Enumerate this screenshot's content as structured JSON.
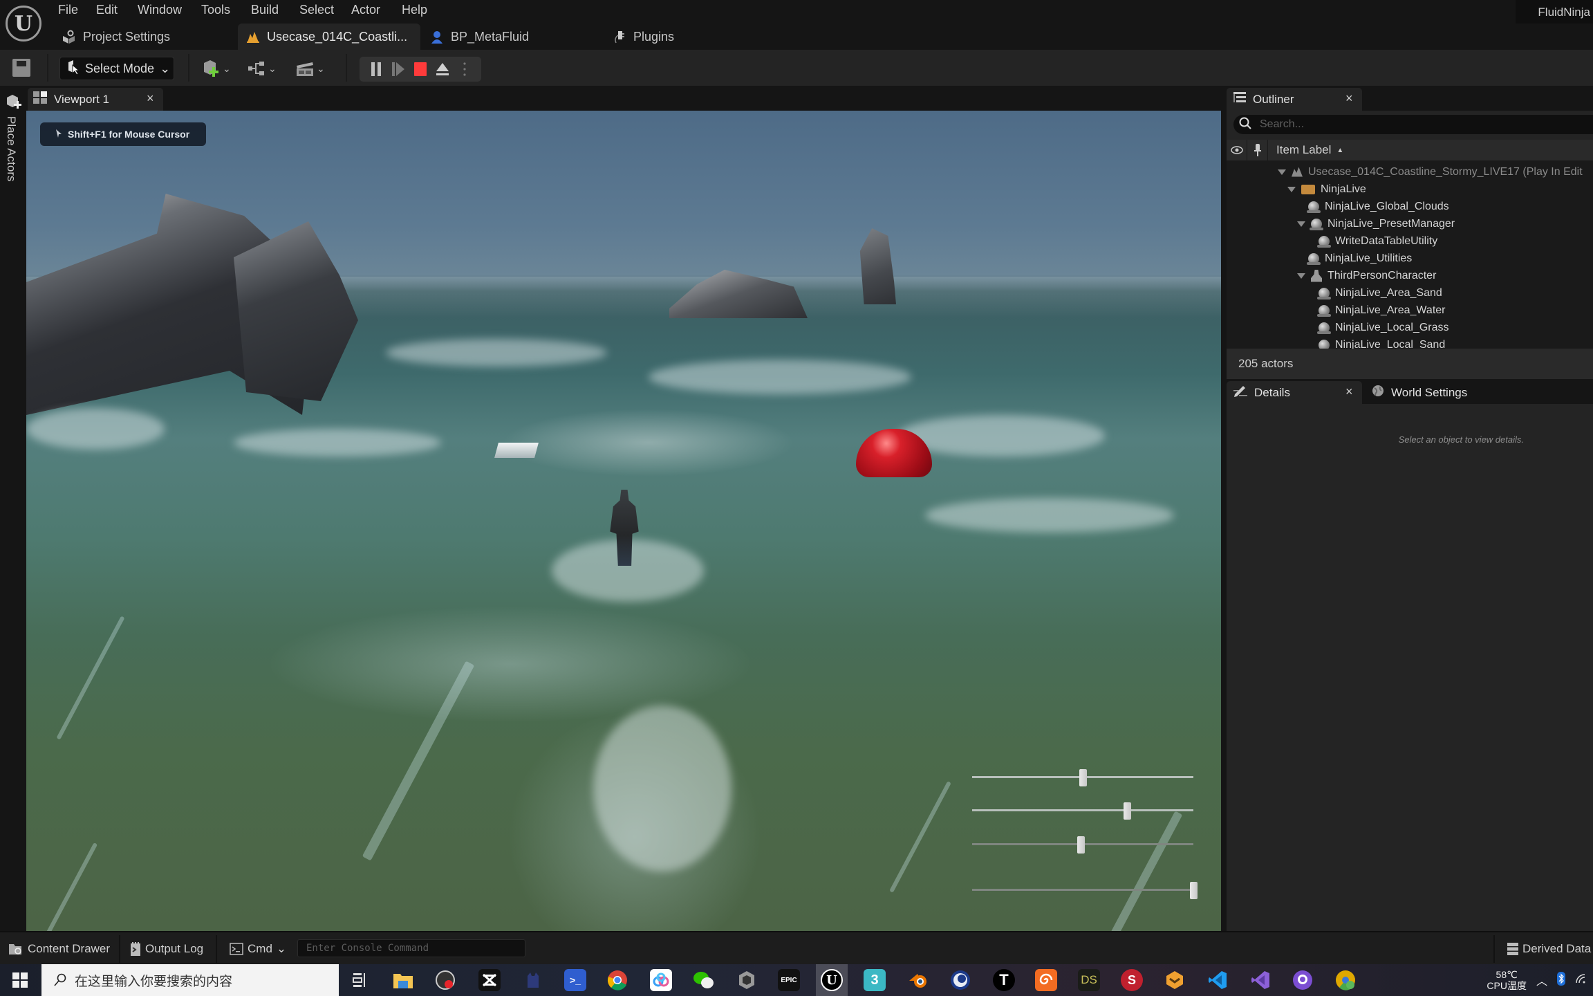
{
  "app": {
    "logo_glyph": "U",
    "project_name": "FluidNinja"
  },
  "menu": {
    "items": [
      "File",
      "Edit",
      "Window",
      "Tools",
      "Build",
      "Select",
      "Actor",
      "Help"
    ]
  },
  "document_tabs": [
    {
      "label": "Project Settings",
      "icon": "settings-icon",
      "active": false
    },
    {
      "label": "Usecase_014C_Coastli...",
      "icon": "level-icon",
      "active": true
    },
    {
      "label": "BP_MetaFluid",
      "icon": "blueprint-icon",
      "active": false
    },
    {
      "label": "Plugins",
      "icon": "plugin-icon",
      "active": false
    }
  ],
  "toolbar": {
    "save_icon": "save-icon",
    "select_mode_label": "Select Mode",
    "add_actor_icon": "add-actor-icon",
    "blueprint_icon": "blueprint-graph-icon",
    "cinematics_icon": "clapperboard-icon",
    "play_controls": [
      "pause-icon",
      "step-icon",
      "stop-icon",
      "eject-icon",
      "more-icon"
    ],
    "stop_color": "#ff3b3b"
  },
  "side_strip": {
    "place_actors_label": "Place Actors"
  },
  "viewport": {
    "tab_label": "Viewport 1",
    "mouse_hint": "Shift+F1 for Mouse Cursor",
    "sliders": [
      {
        "value": 0.5
      },
      {
        "value": 0.7
      },
      {
        "value": 0.49
      },
      {
        "value": 1.0
      }
    ]
  },
  "outliner": {
    "tab_label": "Outliner",
    "search_placeholder": "Search...",
    "column_label": "Item Label",
    "items": [
      {
        "label": "Usecase_014C_Coastline_Stormy_LIVE17 (Play In Edit",
        "depth": 0,
        "icon": "level",
        "expanded": true,
        "dim": true
      },
      {
        "label": "NinjaLive",
        "depth": 1,
        "icon": "folder",
        "expanded": true
      },
      {
        "label": "NinjaLive_Global_Clouds",
        "depth": 2,
        "icon": "actor"
      },
      {
        "label": "NinjaLive_PresetManager",
        "depth": 2,
        "icon": "actor",
        "expanded": true
      },
      {
        "label": "WriteDataTableUtility",
        "depth": 3,
        "icon": "actor"
      },
      {
        "label": "NinjaLive_Utilities",
        "depth": 2,
        "icon": "actor"
      },
      {
        "label": "ThirdPersonCharacter",
        "depth": 2,
        "icon": "character",
        "expanded": true
      },
      {
        "label": "NinjaLive_Area_Sand",
        "depth": 3,
        "icon": "actor"
      },
      {
        "label": "NinjaLive_Area_Water",
        "depth": 3,
        "icon": "actor"
      },
      {
        "label": "NinjaLive_Local_Grass",
        "depth": 3,
        "icon": "actor"
      },
      {
        "label": "NinjaLive_Local_Sand",
        "depth": 3,
        "icon": "actor"
      }
    ],
    "actor_count": "205 actors"
  },
  "details": {
    "tab_label": "Details",
    "world_settings_label": "World Settings",
    "empty_message": "Select an object to view details."
  },
  "bottom_bar": {
    "content_drawer": "Content Drawer",
    "output_log": "Output Log",
    "cmd_label": "Cmd",
    "console_placeholder": "Enter Console Command",
    "derived_data": "Derived Data"
  },
  "taskbar": {
    "search_placeholder": "在这里输入你要搜索的内容",
    "apps": [
      {
        "name": "task-view",
        "label": ""
      },
      {
        "name": "file-explorer",
        "label": ""
      },
      {
        "name": "obs",
        "label": ""
      },
      {
        "name": "capcut",
        "label": ""
      },
      {
        "name": "cat-app",
        "label": ""
      },
      {
        "name": "powershell",
        "label": ">_"
      },
      {
        "name": "chrome",
        "label": ""
      },
      {
        "name": "baidu-netdisk",
        "label": ""
      },
      {
        "name": "wechat",
        "label": ""
      },
      {
        "name": "unity",
        "label": ""
      },
      {
        "name": "epic-games",
        "label": "EPIC"
      },
      {
        "name": "unreal-engine",
        "label": "U"
      },
      {
        "name": "3ds-max",
        "label": "3"
      },
      {
        "name": "blender",
        "label": ""
      },
      {
        "name": "cinema4d",
        "label": ""
      },
      {
        "name": "typora",
        "label": "T"
      },
      {
        "name": "houdini",
        "label": ""
      },
      {
        "name": "substance-designer",
        "label": "DS"
      },
      {
        "name": "substance-painter",
        "label": "S"
      },
      {
        "name": "marmoset",
        "label": ""
      },
      {
        "name": "vscode",
        "label": ""
      },
      {
        "name": "visual-studio",
        "label": ""
      },
      {
        "name": "github-desktop",
        "label": ""
      },
      {
        "name": "chrome-canary",
        "label": ""
      }
    ],
    "cpu_temp": "58℃",
    "cpu_label": "CPU温度"
  }
}
